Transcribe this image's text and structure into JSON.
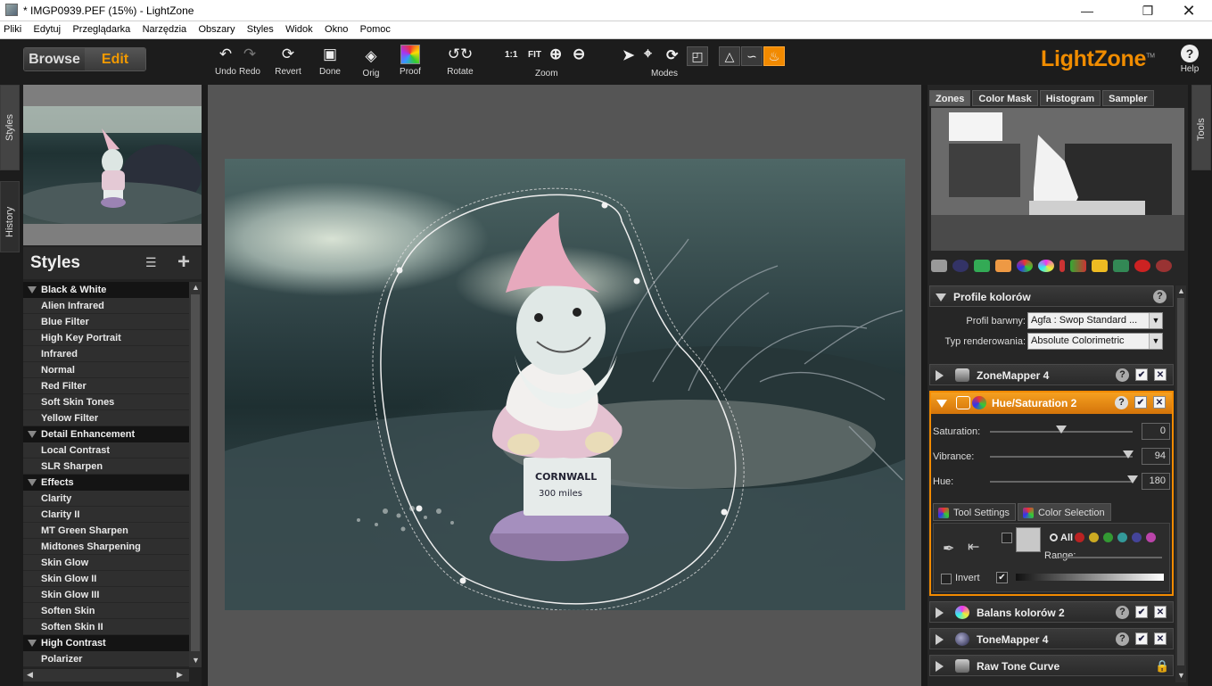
{
  "window": {
    "title": "* IMGP0939.PEF (15%) - LightZone"
  },
  "menu": [
    "Pliki",
    "Edytuj",
    "Przeglądarka",
    "Narzędzia",
    "Obszary",
    "Styles",
    "Widok",
    "Okno",
    "Pomoc"
  ],
  "toolbar": {
    "browse": "Browse",
    "edit": "Edit",
    "undo": "Undo",
    "redo": "Redo",
    "revert": "Revert",
    "done": "Done",
    "orig": "Orig",
    "proof": "Proof",
    "rotate": "Rotate",
    "zoom_1to1": "1:1",
    "zoom_fit": "FIT",
    "zoom": "Zoom",
    "modes": "Modes",
    "logo": "LightZone",
    "logo_tm": "TM",
    "help": "Help"
  },
  "side_tabs": {
    "styles": "Styles",
    "history": "History",
    "tools": "Tools"
  },
  "styles_panel": {
    "title": "Styles",
    "rows": [
      {
        "type": "cat",
        "label": "Black & White"
      },
      {
        "type": "item",
        "label": "Alien Infrared"
      },
      {
        "type": "item",
        "label": "Blue Filter"
      },
      {
        "type": "item",
        "label": "High Key Portrait"
      },
      {
        "type": "item",
        "label": "Infrared"
      },
      {
        "type": "item",
        "label": "Normal"
      },
      {
        "type": "item",
        "label": "Red Filter"
      },
      {
        "type": "item",
        "label": "Soft Skin Tones"
      },
      {
        "type": "item",
        "label": "Yellow Filter"
      },
      {
        "type": "cat",
        "label": "Detail Enhancement"
      },
      {
        "type": "item",
        "label": "Local Contrast"
      },
      {
        "type": "item",
        "label": "SLR Sharpen"
      },
      {
        "type": "cat",
        "label": "Effects"
      },
      {
        "type": "item",
        "label": "Clarity"
      },
      {
        "type": "item",
        "label": "Clarity II"
      },
      {
        "type": "item",
        "label": "MT Green Sharpen"
      },
      {
        "type": "item",
        "label": "Midtones Sharpening"
      },
      {
        "type": "item",
        "label": "Skin Glow"
      },
      {
        "type": "item",
        "label": "Skin Glow II"
      },
      {
        "type": "item",
        "label": "Skin Glow III"
      },
      {
        "type": "item",
        "label": "Soften Skin"
      },
      {
        "type": "item",
        "label": "Soften Skin II"
      },
      {
        "type": "cat",
        "label": "High Contrast"
      },
      {
        "type": "item",
        "label": "Polarizer"
      }
    ]
  },
  "photo": {
    "sign_line1": "CORNWALL",
    "sign_line2": "300 miles"
  },
  "right_panel": {
    "tabs": [
      "Zones",
      "Color Mask",
      "Histogram",
      "Sampler"
    ],
    "profile": {
      "title": "Profile kolorów",
      "profile_label": "Profil barwny:",
      "profile_value": "Agfa : Swop Standard ...",
      "render_label": "Typ renderowania:",
      "render_value": "Absolute Colorimetric"
    },
    "zonemapper": "ZoneMapper 4",
    "huesat": {
      "title": "Hue/Saturation 2",
      "saturation_label": "Saturation:",
      "saturation": "0",
      "vibrance_label": "Vibrance:",
      "vibrance": "94",
      "hue_label": "Hue:",
      "hue": "180",
      "tab_tool_settings": "Tool Settings",
      "tab_color_selection": "Color Selection",
      "all": "All",
      "range": "Range:",
      "invert": "Invert"
    },
    "balans": "Balans kolorów 2",
    "tonemapper": "ToneMapper 4",
    "rawtone": "Raw Tone Curve",
    "help_mark": "?",
    "check_mark": "✔",
    "close_mark": "✕"
  },
  "colors": {
    "accent": "#f28a00",
    "logo": "#f08c00"
  }
}
